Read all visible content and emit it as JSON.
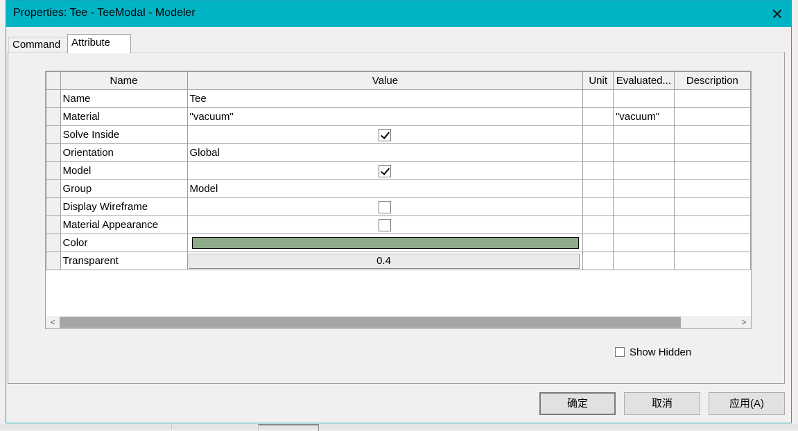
{
  "window": {
    "title": "Properties: Tee - TeeModal - Modeler",
    "titlebar_color": "#00b4c6"
  },
  "tabs": [
    {
      "label": "Command",
      "active": false
    },
    {
      "label": "Attribute",
      "active": true
    }
  ],
  "grid": {
    "columns": [
      "Name",
      "Value",
      "Unit",
      "Evaluated...",
      "Description"
    ],
    "rows": [
      {
        "name": "Name",
        "value": "Tee",
        "unit": "",
        "evaluated": "",
        "description": ""
      },
      {
        "name": "Material",
        "value": "\"vacuum\"",
        "unit": "",
        "evaluated": "\"vacuum\"",
        "description": ""
      },
      {
        "name": "Solve Inside",
        "checked": true,
        "unit": "",
        "evaluated": "",
        "description": ""
      },
      {
        "name": "Orientation",
        "value": "Global",
        "unit": "",
        "evaluated": "",
        "description": ""
      },
      {
        "name": "Model",
        "checked": true,
        "unit": "",
        "evaluated": "",
        "description": ""
      },
      {
        "name": "Group",
        "value": "Model",
        "unit": "",
        "evaluated": "",
        "description": ""
      },
      {
        "name": "Display Wireframe",
        "checked": false,
        "unit": "",
        "evaluated": "",
        "description": ""
      },
      {
        "name": "Material Appearance",
        "checked": false,
        "unit": "",
        "evaluated": "",
        "description": ""
      },
      {
        "name": "Color",
        "color": "#8faa8a",
        "unit": "",
        "evaluated": "",
        "description": ""
      },
      {
        "name": "Transparent",
        "value": "0.4",
        "unit": "",
        "evaluated": "",
        "description": ""
      }
    ]
  },
  "scrollbar": {
    "left_arrow": "<",
    "right_arrow": ">"
  },
  "show_hidden": {
    "label": "Show Hidden",
    "checked": false
  },
  "buttons": {
    "ok": "确定",
    "cancel": "取消",
    "apply": "应用(A)"
  }
}
